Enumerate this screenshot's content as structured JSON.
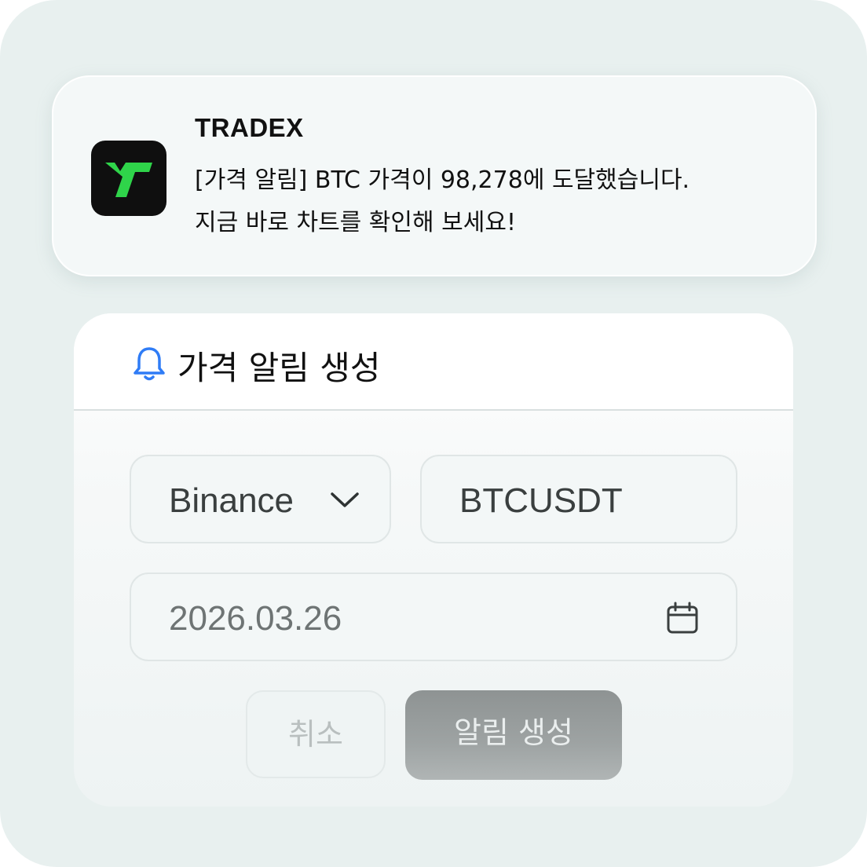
{
  "notification": {
    "app_name": "TRADEX",
    "line1": "[가격 알림] BTC 가격이 98,278에 도달했습니다.",
    "line2": "지금 바로 차트를 확인해 보세요!",
    "icon": "tradex-logo-icon",
    "logo_color": "#2fd44a"
  },
  "form": {
    "title": "가격 알림 생성",
    "title_icon": "bell-icon",
    "accent_color": "#2f7cf6",
    "exchange": {
      "value": "Binance",
      "icon": "chevron-down-icon"
    },
    "symbol": {
      "value": "BTCUSDT"
    },
    "date": {
      "value": "2026.03.26",
      "icon": "calendar-icon"
    },
    "cancel_label": "취소",
    "submit_label": "알림 생성"
  }
}
